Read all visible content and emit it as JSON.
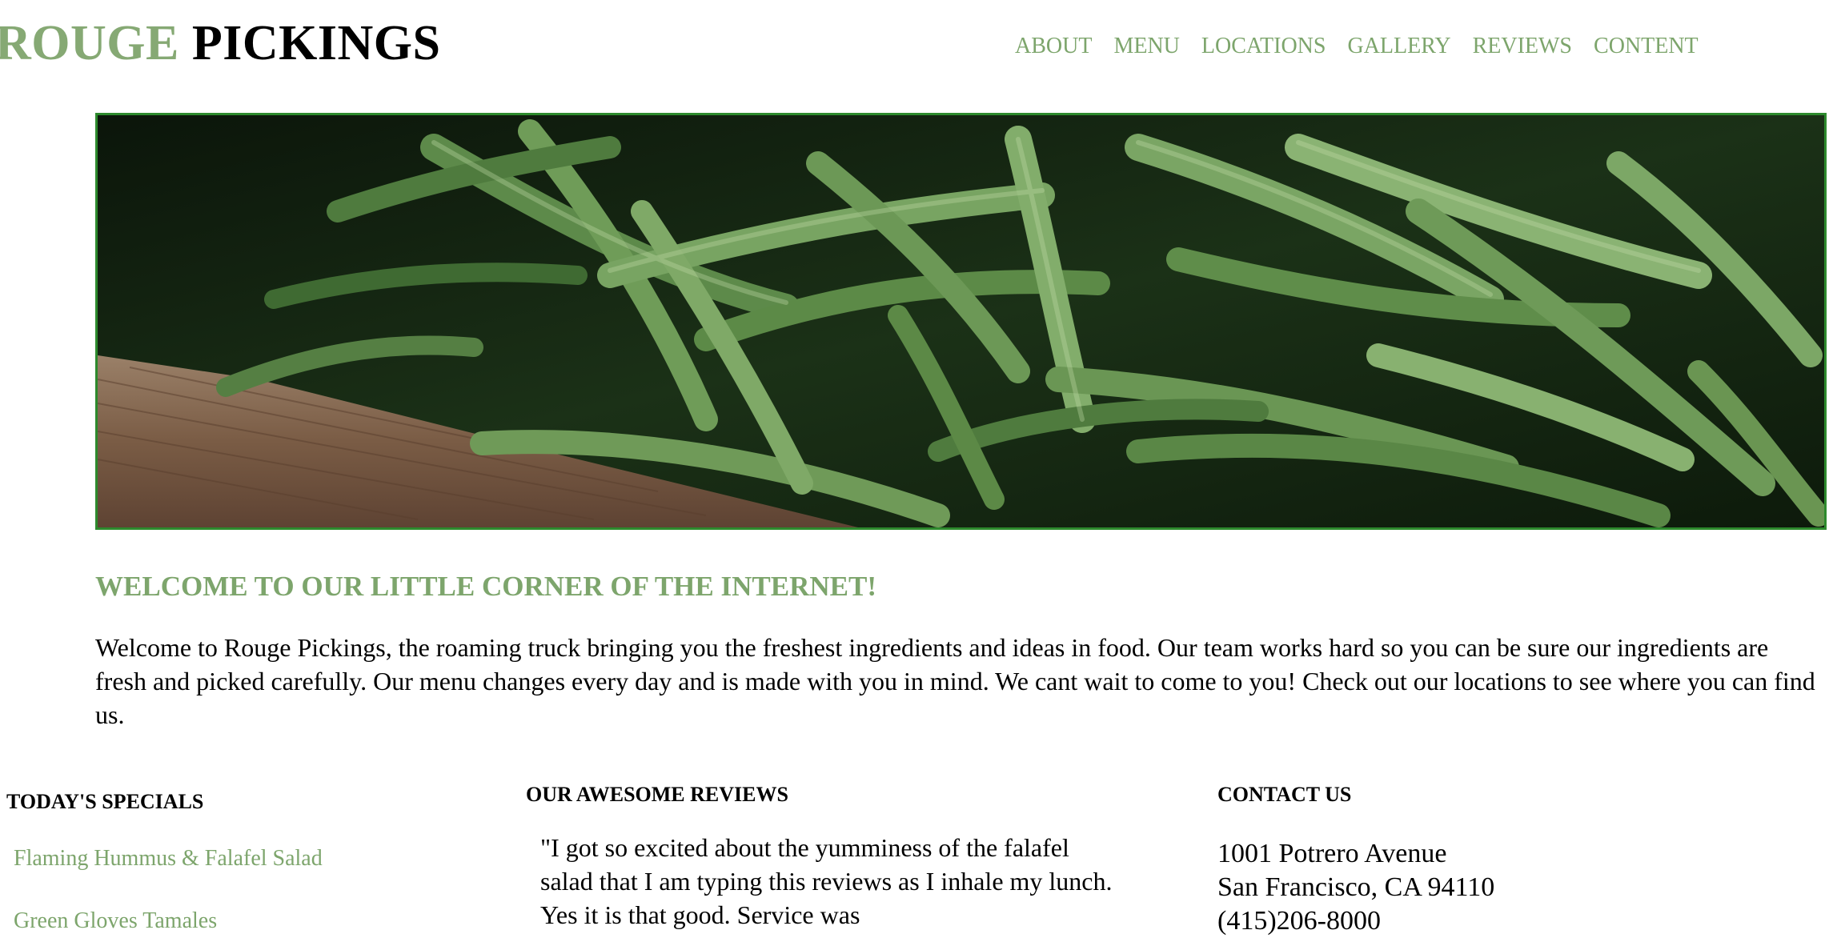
{
  "brand": {
    "accent": "ROUGE",
    "rest": "PICKINGS"
  },
  "nav": {
    "items": [
      "ABOUT",
      "MENU",
      "LOCATIONS",
      "GALLERY",
      "REVIEWS",
      "CONTENT"
    ]
  },
  "hero": {
    "image": "green-beans-photo"
  },
  "welcome": {
    "title": "WELCOME TO OUR LITTLE CORNER OF THE INTERNET!",
    "body": "Welcome to Rouge Pickings, the roaming truck bringing you the freshest ingredients and ideas in food. Our team works hard so you can be sure our ingredients are fresh and picked carefully. Our menu changes every day and is made with you in mind. We cant wait to come to you! Check out our locations to see where you can find us."
  },
  "specials": {
    "title": "TODAY'S SPECIALS",
    "items": [
      "Flaming Hummus & Falafel Salad",
      "Green Gloves Tamales"
    ]
  },
  "reviews": {
    "title": "OUR AWESOME REVIEWS",
    "text": "\"I got so excited about the yumminess of the falafel salad that I am typing this reviews as I inhale my lunch. Yes it is that good. Service was"
  },
  "contact": {
    "title": "CONTACT US",
    "street": "1001 Potrero Avenue",
    "city": "San Francisco, CA 94110",
    "phone": "(415)206-8000"
  },
  "colors": {
    "accent": "#7da56c",
    "hero_border": "#2d8a2d"
  }
}
